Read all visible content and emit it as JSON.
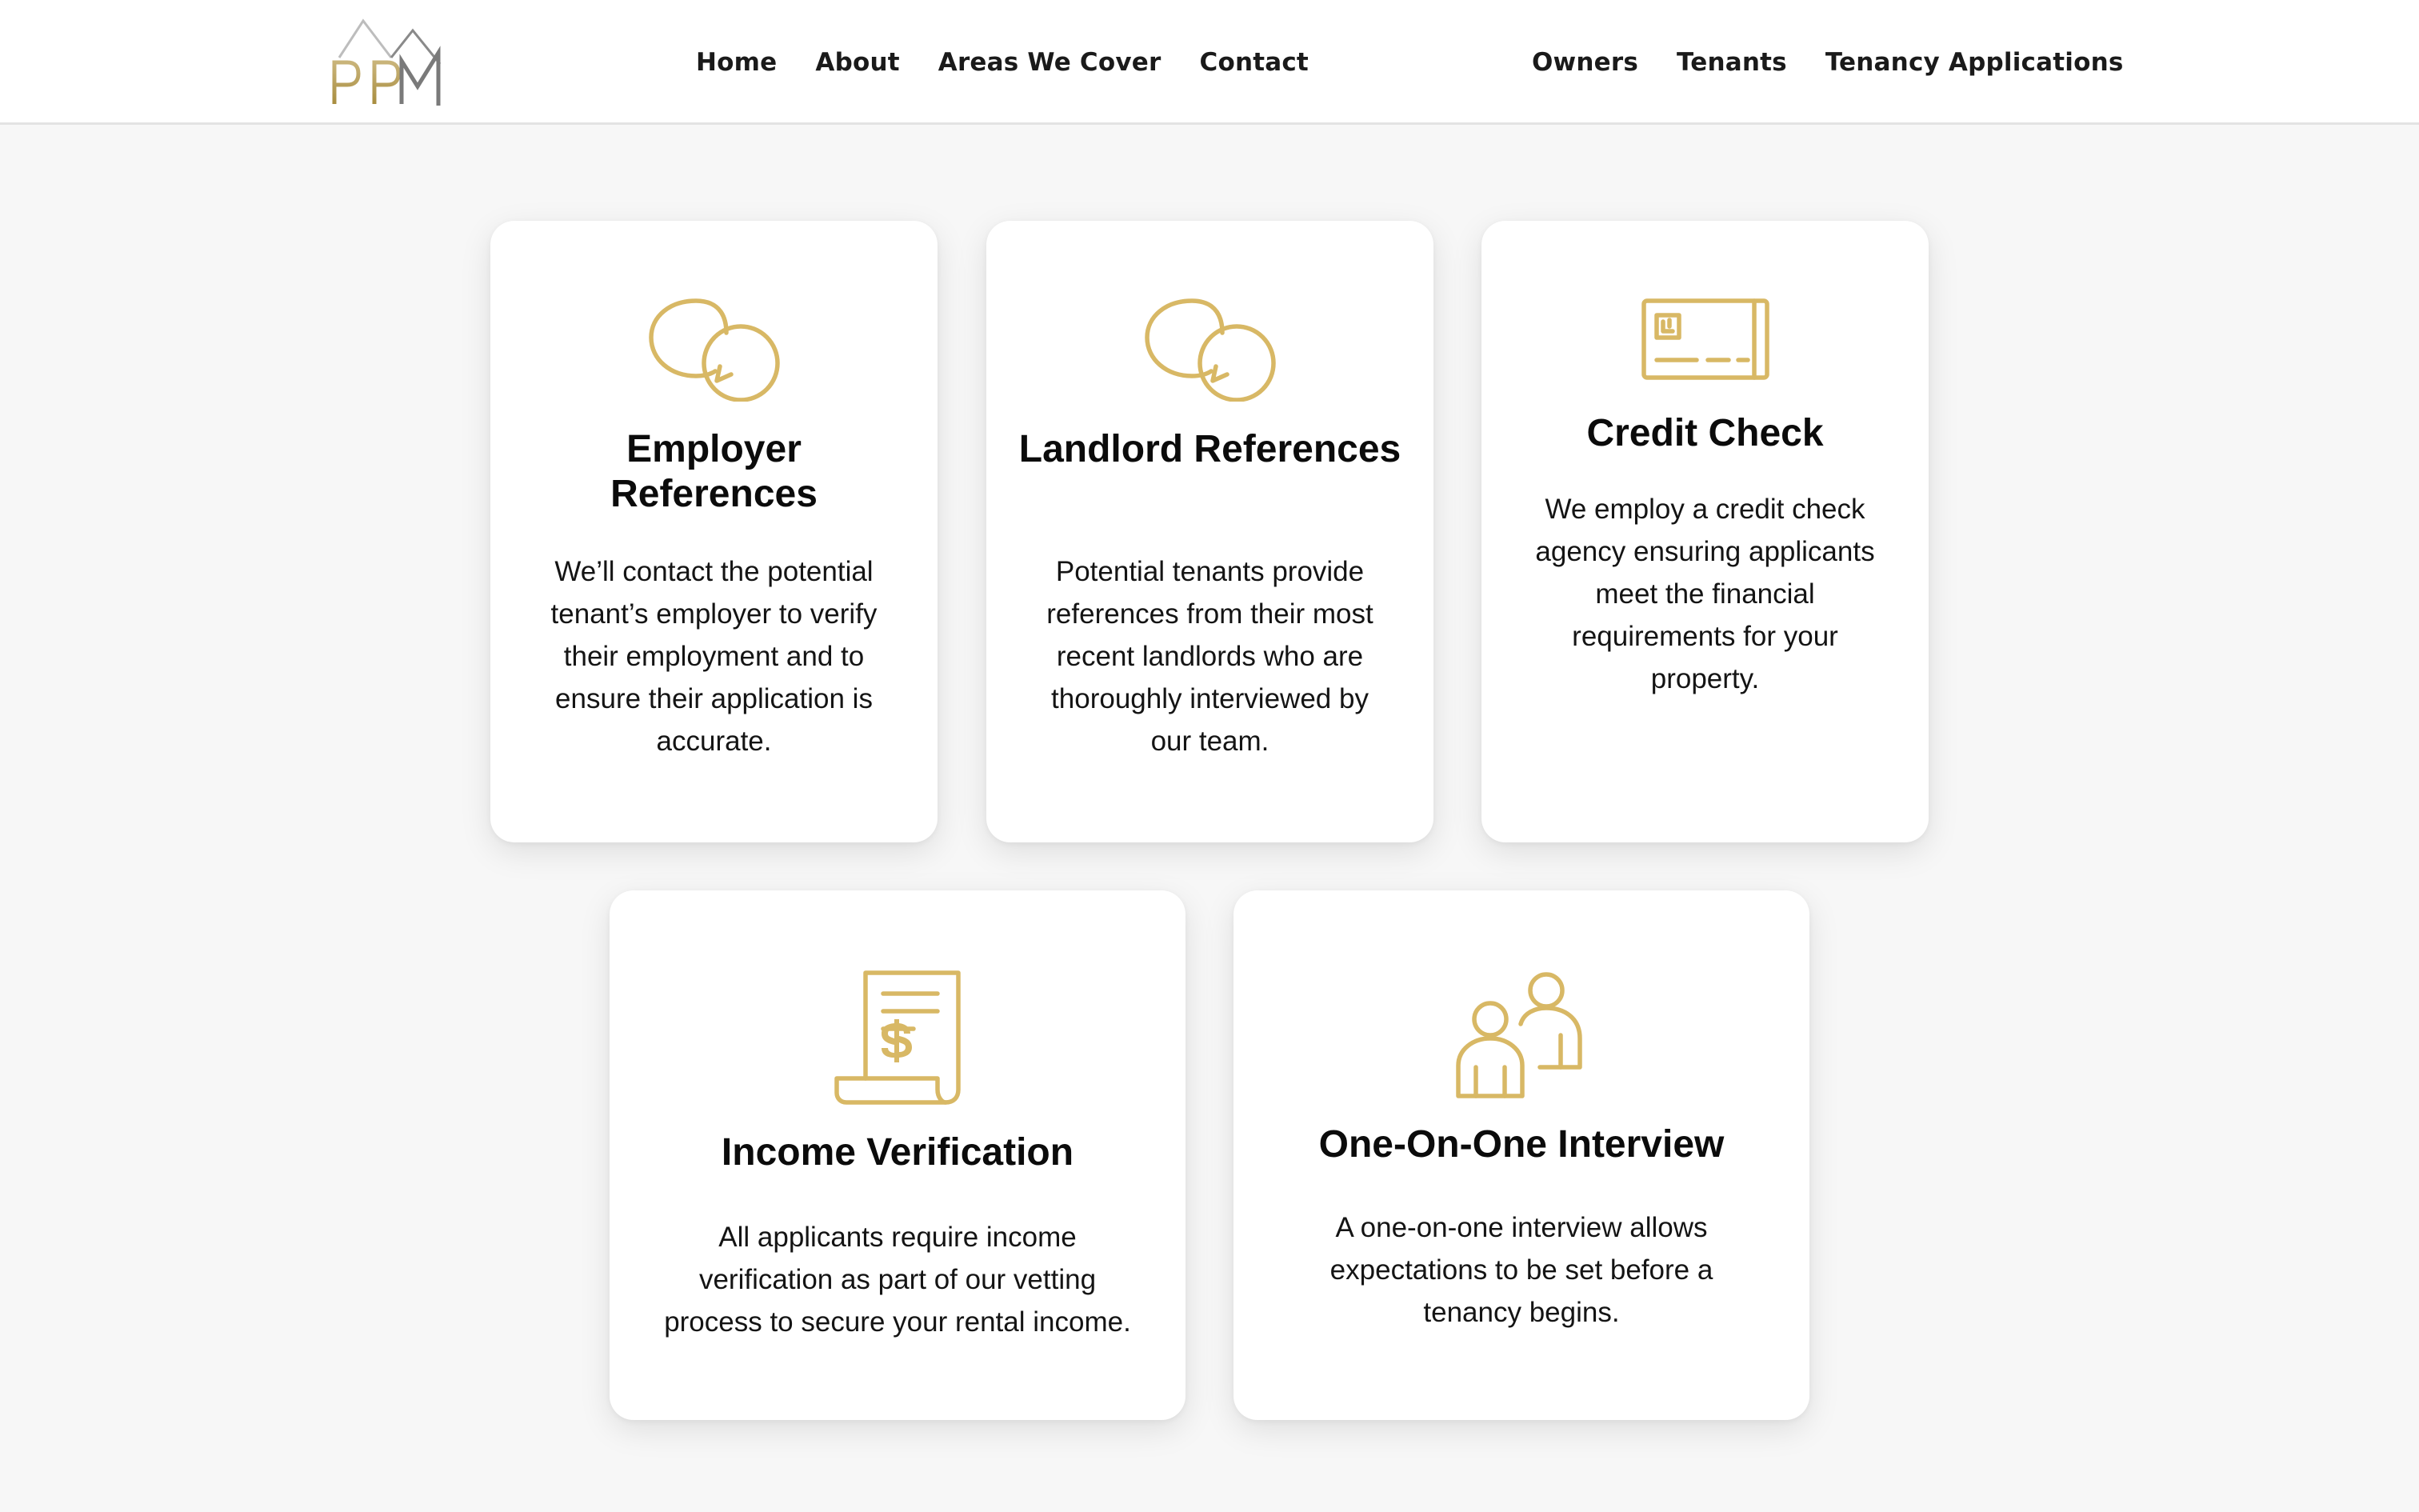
{
  "brand": {
    "logo_text": "PPM",
    "accent_color": "#d8b865"
  },
  "nav": {
    "primary": [
      {
        "label": "Home"
      },
      {
        "label": "About"
      },
      {
        "label": "Areas We Cover"
      },
      {
        "label": "Contact"
      }
    ],
    "secondary": [
      {
        "label": "Owners"
      },
      {
        "label": "Tenants"
      },
      {
        "label": "Tenancy Applications"
      }
    ]
  },
  "cards": [
    {
      "icon": "speech-bubbles-icon",
      "title": "Employer References",
      "description": "We’ll contact the potential tenant’s employer to verify their employment and to ensure their application is accurate."
    },
    {
      "icon": "speech-bubbles-icon",
      "title": "Landlord References",
      "description": "Potential tenants provide references from their most recent landlords who are thoroughly interviewed by our team."
    },
    {
      "icon": "credit-card-icon",
      "title": "Credit Check",
      "description": "We employ a credit check agency ensuring applicants meet the financial requirements for your property."
    },
    {
      "icon": "invoice-dollar-icon",
      "title": "Income Verification",
      "description": "All applicants require income verification as part of our vetting process to secure your rental income."
    },
    {
      "icon": "two-people-icon",
      "title": "One-On-One Interview",
      "description": "A one-on-one interview allows expectations to be set before a tenancy begins."
    }
  ]
}
